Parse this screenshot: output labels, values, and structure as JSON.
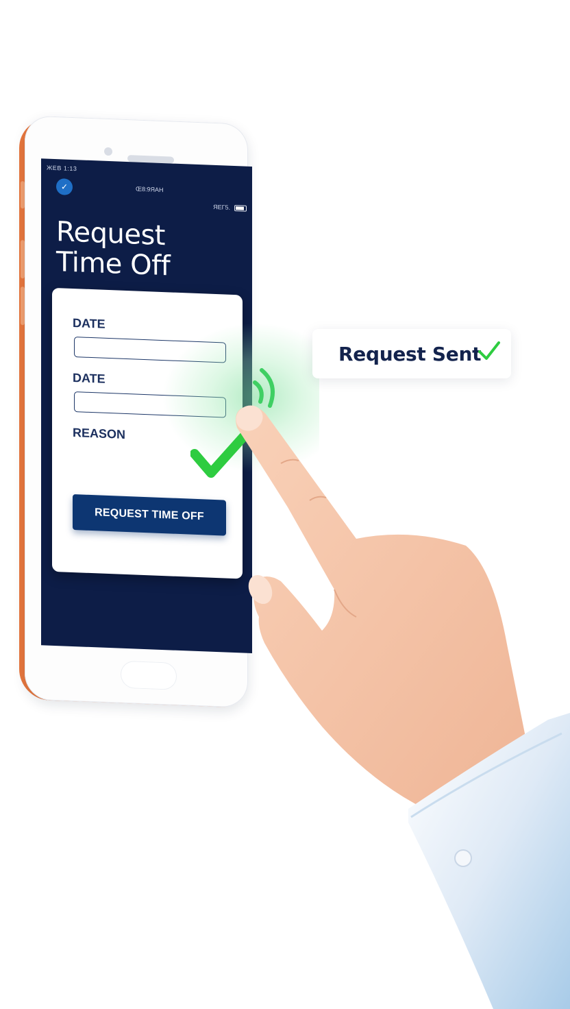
{
  "phone": {
    "status_left": "ЖЕВ 1:13",
    "status_center": "Œ8:9ЯАН",
    "status_right": "ЯЕГ5.",
    "app_icon": "checkmark-logo-icon"
  },
  "form": {
    "title": "Request Time Off",
    "fields": [
      {
        "label": "DATE",
        "value": ""
      },
      {
        "label": "DATE",
        "value": ""
      },
      {
        "label": "REASON",
        "value": ""
      }
    ],
    "submit_label": "REQUEST TIME OFF"
  },
  "toast": {
    "text": "Request Sent",
    "icon": "checkmark-icon"
  },
  "colors": {
    "screen_bg": "#0d1d47",
    "button_bg": "#0d3672",
    "phone_edge": "#e8773d",
    "success_green": "#2ecc40",
    "text_dark": "#13234d"
  }
}
